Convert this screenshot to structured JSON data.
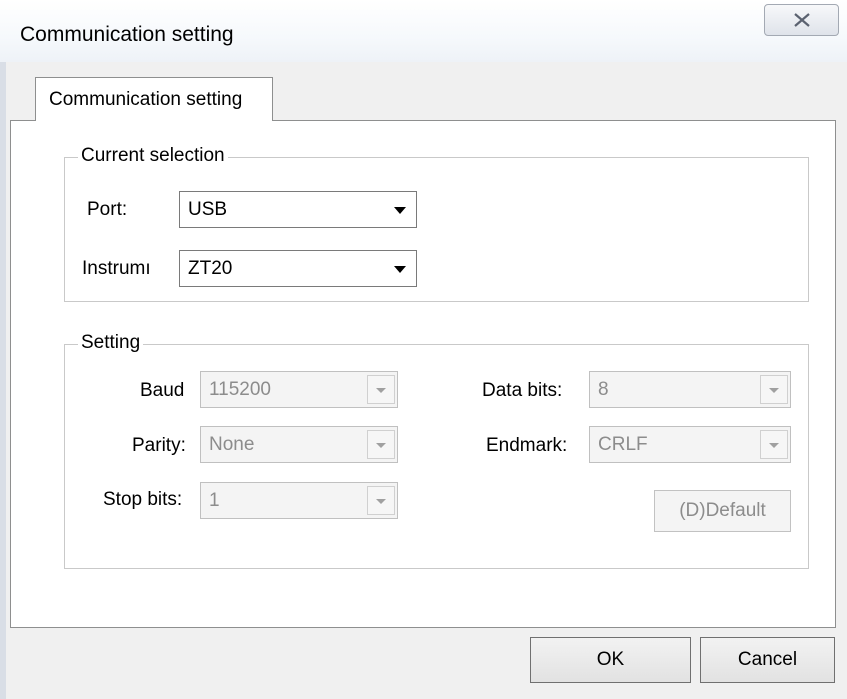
{
  "window": {
    "title": "Communication setting"
  },
  "tab": {
    "label": "Communication setting"
  },
  "current_selection": {
    "title": "Current selection",
    "port": {
      "label": "Port:",
      "value": "USB"
    },
    "instrument": {
      "label": "Instrumı",
      "value": "ZT20"
    }
  },
  "setting": {
    "title": "Setting",
    "baud": {
      "label": "Baud",
      "value": "115200"
    },
    "parity": {
      "label": "Parity:",
      "value": "None"
    },
    "stop_bits": {
      "label": "Stop bits:",
      "value": "1"
    },
    "data_bits": {
      "label": "Data bits:",
      "value": "8"
    },
    "endmark": {
      "label": "Endmark:",
      "value": "CRLF"
    },
    "default_button": "(D)Default"
  },
  "buttons": {
    "ok": "OK",
    "cancel": "Cancel"
  },
  "icons": {
    "close": "close-icon",
    "dropdown": "chevron-down-icon"
  }
}
